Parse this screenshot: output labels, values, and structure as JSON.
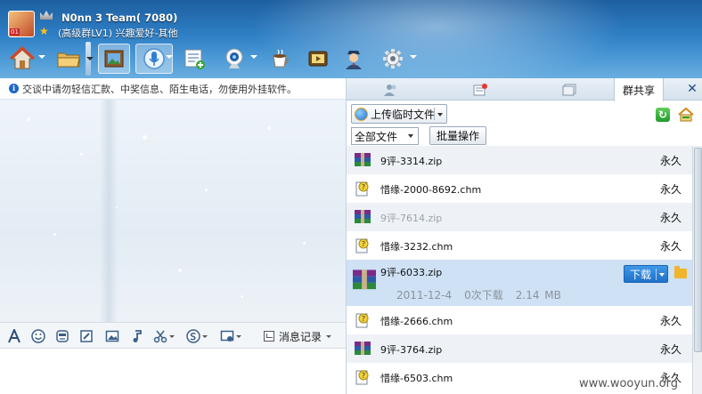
{
  "window": {
    "title": "N0nn    3 Team(        7080)",
    "subtitle": "(高级群LV1) 兴趣爱好-其他",
    "avatar_badge": "01"
  },
  "toolbar": {
    "buttons": [
      {
        "name": "home-icon",
        "caret": true
      },
      {
        "name": "share-folder-icon",
        "caret": true
      },
      {
        "name": "album-icon",
        "caret": false
      },
      {
        "name": "voice-icon",
        "caret": true
      },
      {
        "name": "bulletin-icon",
        "caret": false
      },
      {
        "name": "video-icon",
        "caret": true
      },
      {
        "name": "coffee-icon",
        "caret": false
      },
      {
        "name": "movie-icon",
        "caret": false
      },
      {
        "name": "admin-icon",
        "caret": false
      },
      {
        "name": "settings-icon",
        "caret": true
      }
    ]
  },
  "notice": {
    "text": "交谈中请勿轻信汇款、中奖信息、陌生电话，勿使用外挂软件。"
  },
  "edit_toolbar": {
    "history_label": "消息记录"
  },
  "right_panel": {
    "tabs": [
      {
        "icon": "members-icon",
        "label": ""
      },
      {
        "icon": "announce-icon",
        "label": ""
      },
      {
        "icon": "album-tab-icon",
        "label": ""
      },
      {
        "icon": "",
        "label": "群共享"
      }
    ],
    "close_label": "✕",
    "upload_label": "上传临时文件",
    "filter_value": "全部文件",
    "batch_label": "批量操作",
    "files": [
      {
        "name": "9评-3314.zip",
        "type": "zip",
        "expiry": "永久",
        "faded": false
      },
      {
        "name": "惜缘-2000-8692.chm",
        "type": "chm",
        "expiry": "永久",
        "faded": false
      },
      {
        "name": "9评-7614.zip",
        "type": "zip",
        "expiry": "永久",
        "faded": true
      },
      {
        "name": "惜缘-3232.chm",
        "type": "chm",
        "expiry": "永久",
        "faded": false
      },
      {
        "name": "9评-6033.zip",
        "type": "zip",
        "expiry": "",
        "faded": false,
        "selected": true,
        "date": "2011-12-4",
        "downloads": "0次下载",
        "size": "2.14 MB",
        "download_label": "下载"
      },
      {
        "name": "惜缘-2666.chm",
        "type": "chm",
        "expiry": "永久",
        "faded": false
      },
      {
        "name": "9评-3764.zip",
        "type": "zip",
        "expiry": "永久",
        "faded": false
      },
      {
        "name": "惜缘-6503.chm",
        "type": "chm",
        "expiry": "永久",
        "faded": false
      }
    ]
  },
  "watermark": "www.wooyun.org",
  "colors": {
    "header": "#2e7fc5",
    "selected_row": "#cfe1f4",
    "download_button": "#1e72c9"
  }
}
